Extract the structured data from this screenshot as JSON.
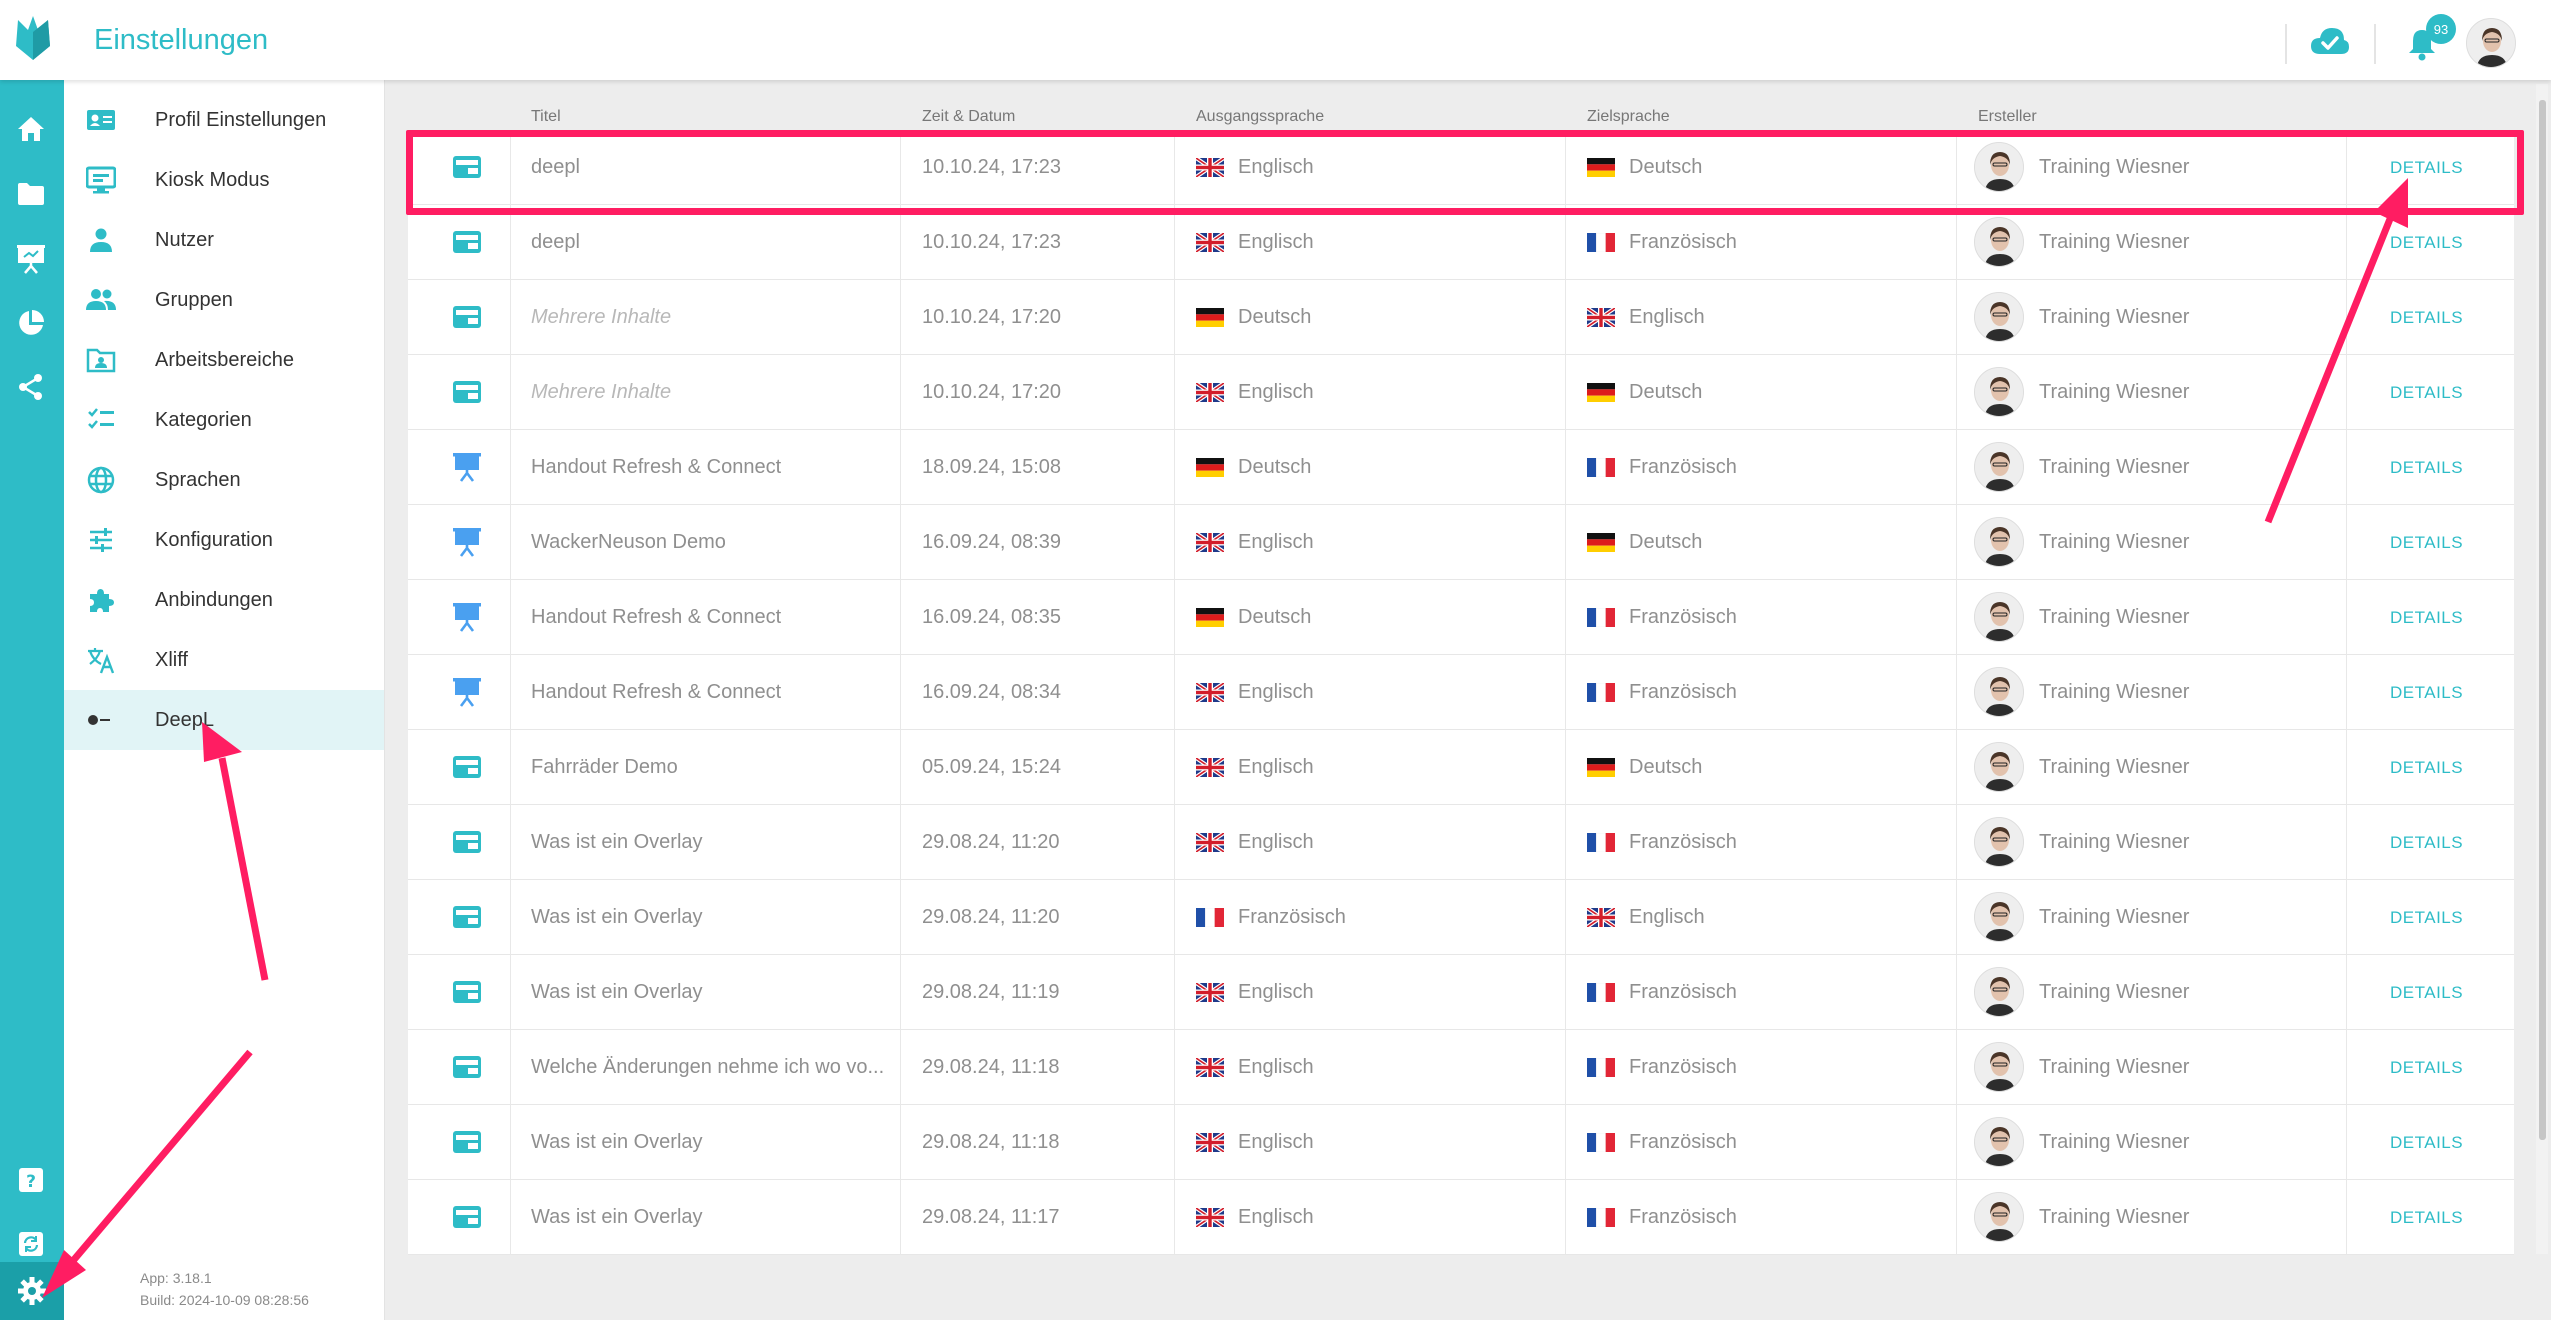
{
  "header": {
    "title": "Einstellungen",
    "notification_count": "93"
  },
  "rail": {
    "items": [
      "home-icon",
      "folder-icon",
      "presentation-icon",
      "pie-chart-icon",
      "share-icon",
      "help-icon",
      "sync-icon",
      "settings-icon"
    ]
  },
  "sidebar": {
    "items": [
      {
        "label": "Profil Einstellungen",
        "icon": "profile-card-icon"
      },
      {
        "label": "Kiosk Modus",
        "icon": "monitor-icon"
      },
      {
        "label": "Nutzer",
        "icon": "person-icon"
      },
      {
        "label": "Gruppen",
        "icon": "group-icon"
      },
      {
        "label": "Arbeitsbereiche",
        "icon": "workspace-icon"
      },
      {
        "label": "Kategorien",
        "icon": "checklist-icon"
      },
      {
        "label": "Sprachen",
        "icon": "globe-icon"
      },
      {
        "label": "Konfiguration",
        "icon": "sliders-icon"
      },
      {
        "label": "Anbindungen",
        "icon": "puzzle-icon"
      },
      {
        "label": "Xliff",
        "icon": "translate-icon"
      },
      {
        "label": "DeepL",
        "icon": "deepl-icon",
        "active": true
      }
    ],
    "app_version": "App: 3.18.1",
    "build": "Build: 2024-10-09 08:28:56"
  },
  "table": {
    "columns": [
      "Titel",
      "Zeit & Datum",
      "Ausgangssprache",
      "Zielsprache",
      "Ersteller"
    ],
    "details_label": "DETAILS",
    "rows": [
      {
        "type": "card",
        "title": "deepl",
        "italic": false,
        "date": "10.10.24, 17:23",
        "src": "Englisch",
        "src_flag": "gb",
        "tgt": "Deutsch",
        "tgt_flag": "de",
        "author": "Training Wiesner"
      },
      {
        "type": "card",
        "title": "deepl",
        "italic": false,
        "date": "10.10.24, 17:23",
        "src": "Englisch",
        "src_flag": "gb",
        "tgt": "Französisch",
        "tgt_flag": "fr",
        "author": "Training Wiesner"
      },
      {
        "type": "card",
        "title": "Mehrere Inhalte",
        "italic": true,
        "date": "10.10.24, 17:20",
        "src": "Deutsch",
        "src_flag": "de",
        "tgt": "Englisch",
        "tgt_flag": "gb",
        "author": "Training Wiesner"
      },
      {
        "type": "card",
        "title": "Mehrere Inhalte",
        "italic": true,
        "date": "10.10.24, 17:20",
        "src": "Englisch",
        "src_flag": "gb",
        "tgt": "Deutsch",
        "tgt_flag": "de",
        "author": "Training Wiesner"
      },
      {
        "type": "presentation",
        "title": "Handout Refresh & Connect",
        "italic": false,
        "date": "18.09.24, 15:08",
        "src": "Deutsch",
        "src_flag": "de",
        "tgt": "Französisch",
        "tgt_flag": "fr",
        "author": "Training Wiesner"
      },
      {
        "type": "presentation",
        "title": "WackerNeuson Demo",
        "italic": false,
        "date": "16.09.24, 08:39",
        "src": "Englisch",
        "src_flag": "gb",
        "tgt": "Deutsch",
        "tgt_flag": "de",
        "author": "Training Wiesner"
      },
      {
        "type": "presentation",
        "title": "Handout Refresh & Connect",
        "italic": false,
        "date": "16.09.24, 08:35",
        "src": "Deutsch",
        "src_flag": "de",
        "tgt": "Französisch",
        "tgt_flag": "fr",
        "author": "Training Wiesner"
      },
      {
        "type": "presentation",
        "title": "Handout Refresh & Connect",
        "italic": false,
        "date": "16.09.24, 08:34",
        "src": "Englisch",
        "src_flag": "gb",
        "tgt": "Französisch",
        "tgt_flag": "fr",
        "author": "Training Wiesner"
      },
      {
        "type": "card",
        "title": "Fahrräder Demo",
        "italic": false,
        "date": "05.09.24, 15:24",
        "src": "Englisch",
        "src_flag": "gb",
        "tgt": "Deutsch",
        "tgt_flag": "de",
        "author": "Training Wiesner"
      },
      {
        "type": "card",
        "title": "Was ist ein Overlay",
        "italic": false,
        "date": "29.08.24, 11:20",
        "src": "Englisch",
        "src_flag": "gb",
        "tgt": "Französisch",
        "tgt_flag": "fr",
        "author": "Training Wiesner"
      },
      {
        "type": "card",
        "title": "Was ist ein Overlay",
        "italic": false,
        "date": "29.08.24, 11:20",
        "src": "Französisch",
        "src_flag": "fr",
        "tgt": "Englisch",
        "tgt_flag": "gb",
        "author": "Training Wiesner"
      },
      {
        "type": "card",
        "title": "Was ist ein Overlay",
        "italic": false,
        "date": "29.08.24, 11:19",
        "src": "Englisch",
        "src_flag": "gb",
        "tgt": "Französisch",
        "tgt_flag": "fr",
        "author": "Training Wiesner"
      },
      {
        "type": "card",
        "title": "Welche Änderungen nehme ich wo vo...",
        "italic": false,
        "date": "29.08.24, 11:18",
        "src": "Englisch",
        "src_flag": "gb",
        "tgt": "Französisch",
        "tgt_flag": "fr",
        "author": "Training Wiesner"
      },
      {
        "type": "card",
        "title": "Was ist ein Overlay",
        "italic": false,
        "date": "29.08.24, 11:18",
        "src": "Englisch",
        "src_flag": "gb",
        "tgt": "Französisch",
        "tgt_flag": "fr",
        "author": "Training Wiesner"
      },
      {
        "type": "card",
        "title": "Was ist ein Overlay",
        "italic": false,
        "date": "29.08.24, 11:17",
        "src": "Englisch",
        "src_flag": "gb",
        "tgt": "Französisch",
        "tgt_flag": "fr",
        "author": "Training Wiesner"
      }
    ]
  },
  "colors": {
    "accent": "#2ebcc7",
    "annotation": "#ff1d62"
  }
}
